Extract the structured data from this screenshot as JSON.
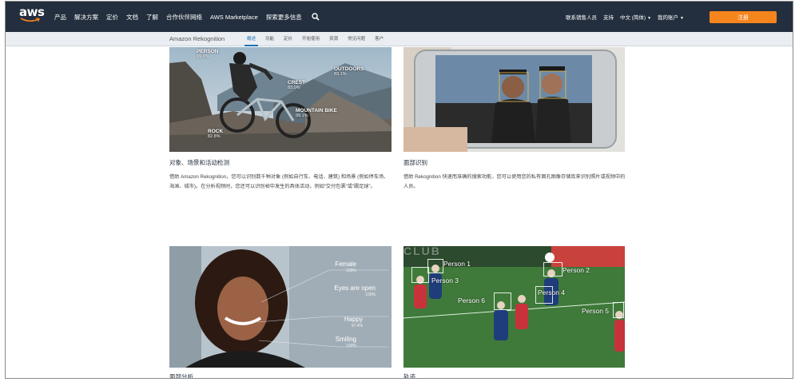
{
  "header": {
    "logo_text": "aws",
    "nav": [
      "产品",
      "解决方案",
      "定价",
      "文档",
      "了解",
      "合作伙伴网络",
      "AWS Marketplace",
      "探索更多信息"
    ],
    "search_icon": "search-icon",
    "right_links": [
      "联系销售人员",
      "支持",
      "中文 (简体)",
      "我的账户"
    ],
    "signup_label": "注册",
    "accent_color": "#f7851e",
    "bar_color": "#232f3e"
  },
  "subnav": {
    "title": "Amazon Rekognition",
    "tabs": [
      "概述",
      "功能",
      "定价",
      "开始使用",
      "资源",
      "常见问题",
      "客户"
    ],
    "active_tab": "概述"
  },
  "cards": [
    {
      "title": "对象、场景和活动检测",
      "desc": "借助 Amazon Rekognition，您可以识别数千种对象 (例如自行车、电话、建筑) 和场景 (例如停车场、海滩、城市)。在分析视频时，您还可以识别帧中发生的具体活动，例如“交付包裹”或“踢足球”。",
      "labels": [
        {
          "name": "PERSON",
          "score": "99.2%"
        },
        {
          "name": "OUTDOORS",
          "score": "83.1%"
        },
        {
          "name": "CREST",
          "score": "83.0%"
        },
        {
          "name": "MOUNTAIN BIKE",
          "score": "99.1%"
        },
        {
          "name": "ROCK",
          "score": "82.8%"
        }
      ]
    },
    {
      "title": "面部识别",
      "desc": "借助 Rekognition 快速而准确的搜索功能，您可以使用您的私有面孔图像存储库来识别照片或视频中的人员。"
    },
    {
      "title": "面部分析",
      "labels": [
        {
          "name": "Female",
          "score": "100%"
        },
        {
          "name": "Eyes are open",
          "score": "100%"
        },
        {
          "name": "Happy",
          "score": "97.4%"
        },
        {
          "name": "Smiling",
          "score": "100%"
        }
      ]
    },
    {
      "title": "轨迹",
      "overlay_text": "CLUB",
      "persons": [
        "Person 1",
        "Person 2",
        "Person 3",
        "Person 4",
        "Person 5",
        "Person 6"
      ]
    }
  ]
}
